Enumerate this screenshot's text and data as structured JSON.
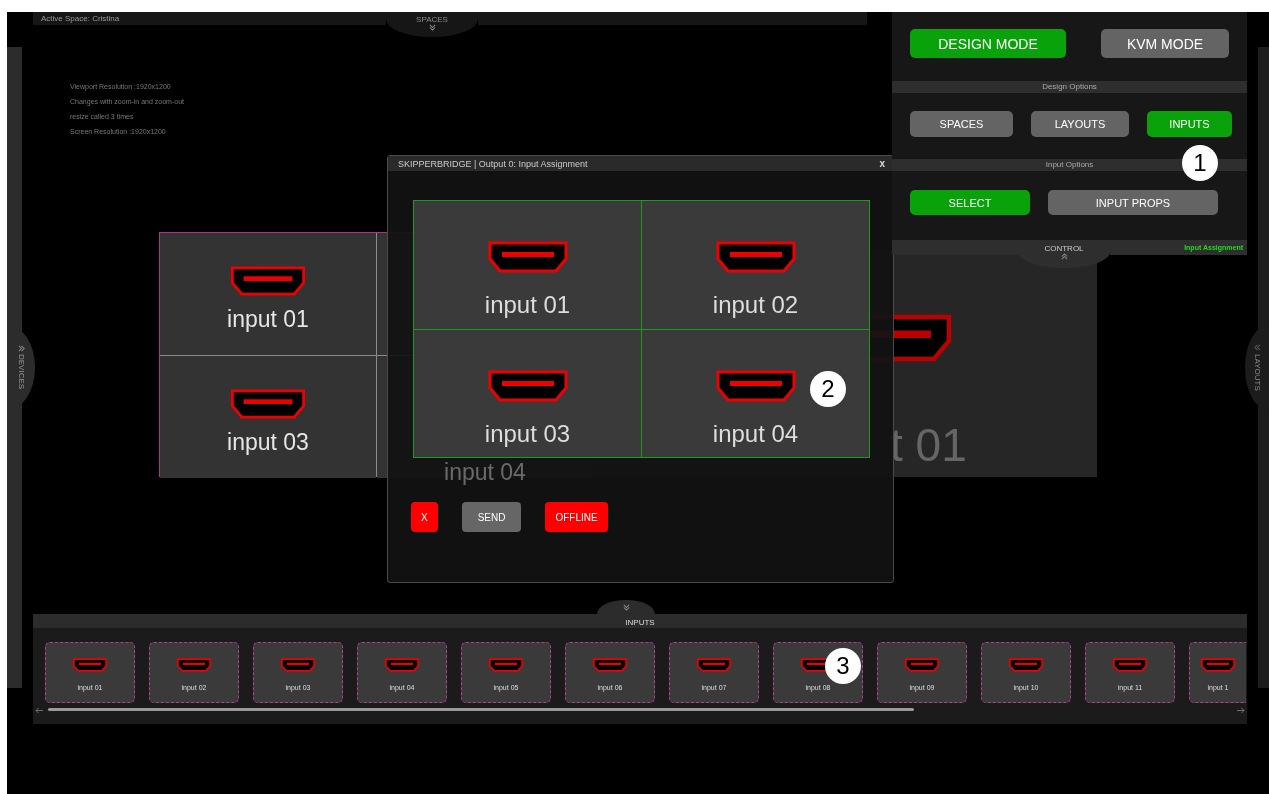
{
  "top_bar": {
    "active_space": "Active Space: Cristina"
  },
  "spaces_tab": {
    "label": "SPACES"
  },
  "devices_tab": {
    "label": "DEVICES"
  },
  "layouts_tab": {
    "label": "LAYOUTS"
  },
  "info_lines": [
    "Viewport Resolution :1920x1200",
    "Changes with zoom-in and zoom-out",
    "resize called 3 times",
    "Screen Resolution :1920x1200"
  ],
  "control_panel": {
    "modes": [
      {
        "label": "DESIGN MODE",
        "selected": true
      },
      {
        "label": "KVM MODE",
        "selected": false
      }
    ],
    "design_options": {
      "title": "Design Options",
      "buttons": [
        {
          "label": "SPACES",
          "selected": false
        },
        {
          "label": "LAYOUTS",
          "selected": false
        },
        {
          "label": "INPUTS",
          "selected": true
        }
      ]
    },
    "input_options": {
      "title": "Input Options",
      "buttons": [
        {
          "label": "SELECT",
          "selected": true
        },
        {
          "label": "INPUT PROPS",
          "selected": false
        }
      ]
    },
    "control_tab": {
      "label": "CONTROL"
    },
    "status": "Input Assignment"
  },
  "layout_preview": {
    "cells": [
      {
        "label": "input 01"
      },
      {
        "label": "input 03"
      },
      {
        "label": "input 04"
      }
    ]
  },
  "output_preview": {
    "label": "t 01"
  },
  "dialog": {
    "title": "SKIPPERBRIDGE | Output 0: Input Assignment",
    "close": "x",
    "inputs": [
      "input 01",
      "input 02",
      "input 03",
      "input 04"
    ],
    "buttons": [
      {
        "label": "X",
        "kind": "danger"
      },
      {
        "label": "SEND",
        "kind": "neutral"
      },
      {
        "label": "OFFLINE",
        "kind": "danger"
      }
    ]
  },
  "inputs_tray": {
    "label": "INPUTS",
    "items": [
      "input 01",
      "input 02",
      "input 03",
      "input 04",
      "input 05",
      "input 06",
      "input 07",
      "input 08",
      "input 09",
      "input 10",
      "input 11",
      "input 1"
    ]
  },
  "callouts": [
    "1",
    "2",
    "3"
  ]
}
